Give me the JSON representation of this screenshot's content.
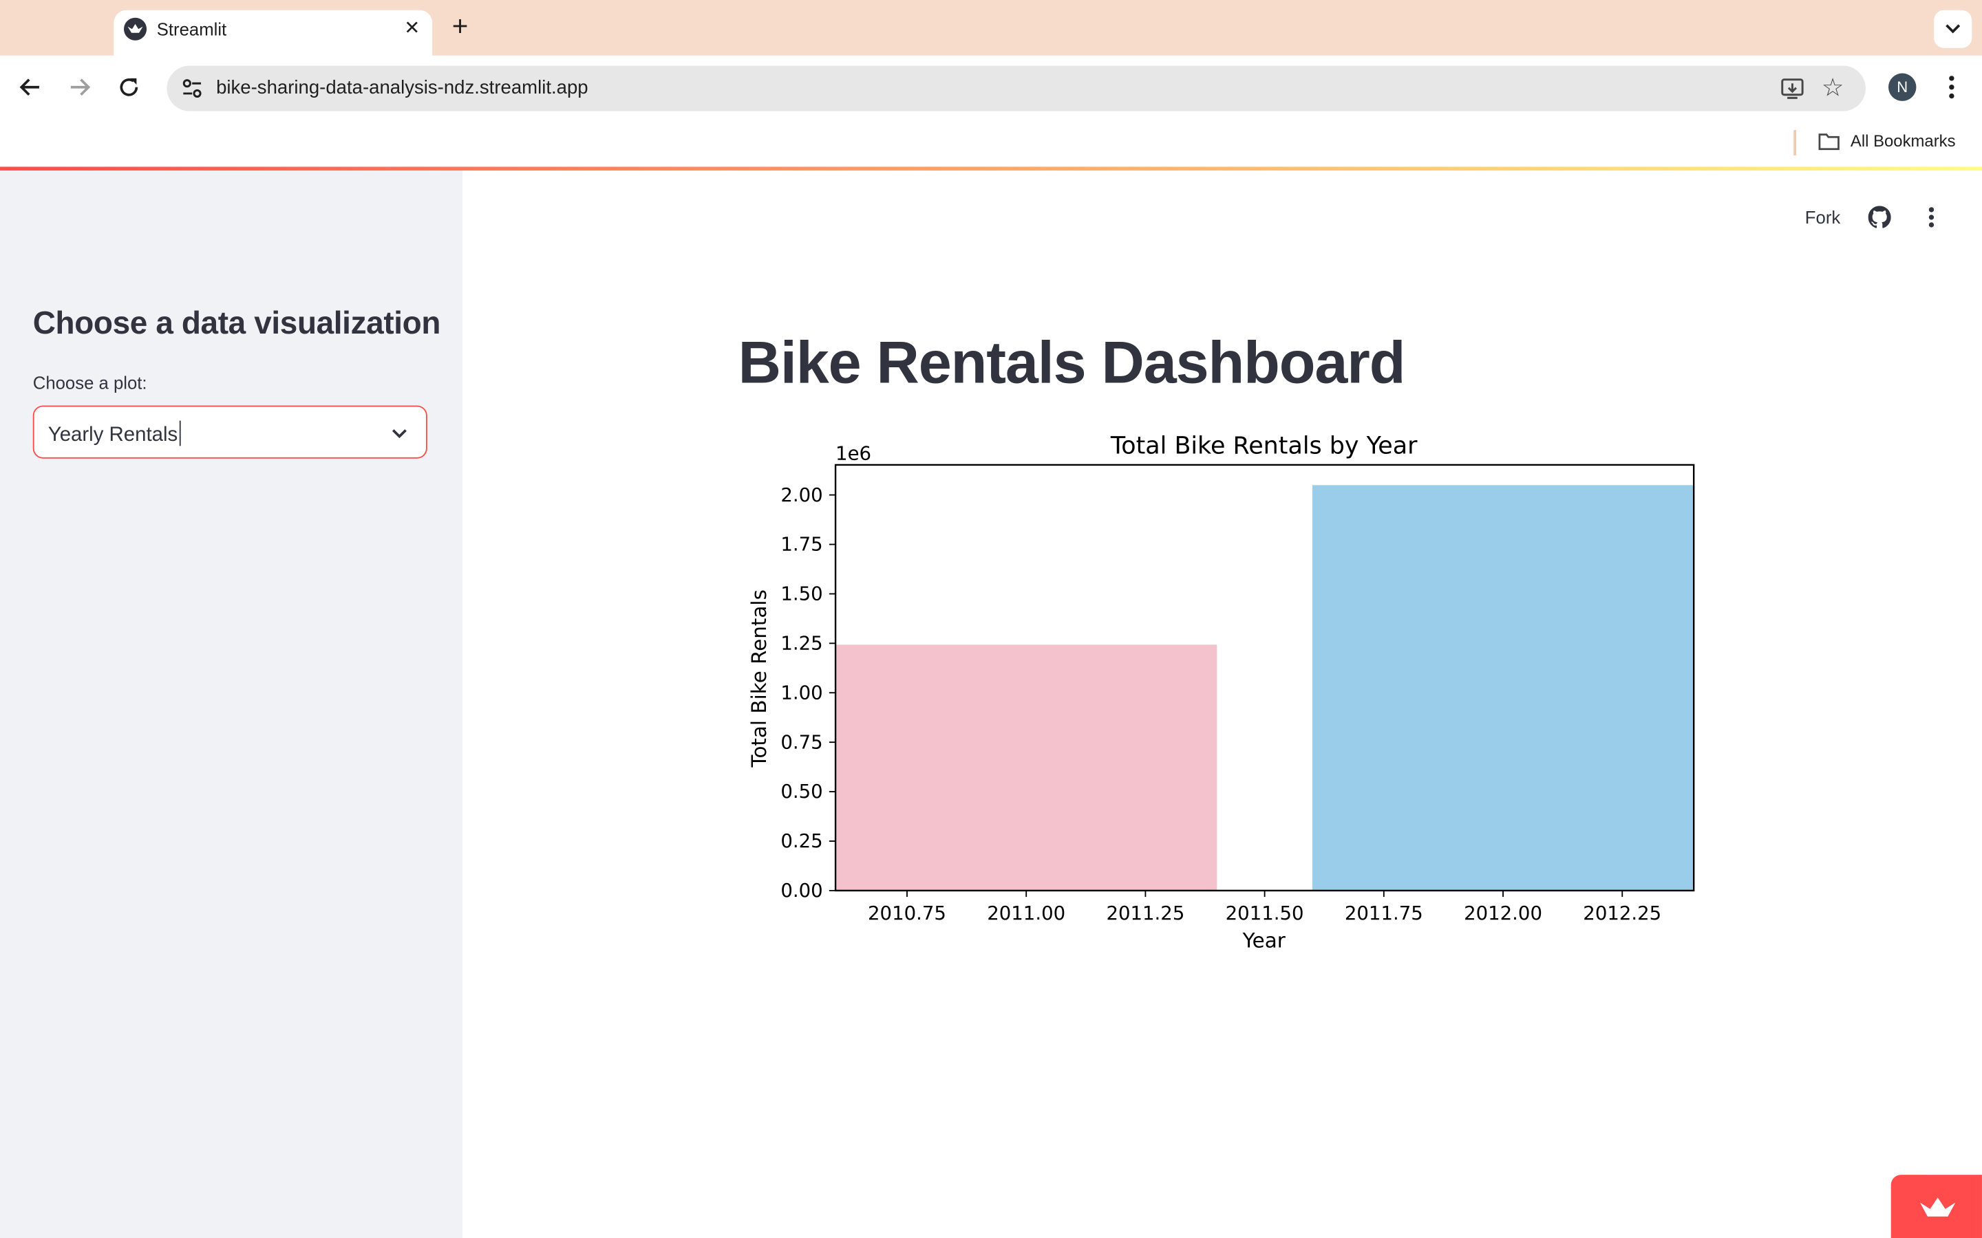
{
  "browser": {
    "tab_title": "Streamlit",
    "url": "bike-sharing-data-analysis-ndz.streamlit.app",
    "bookmarks_label": "All Bookmarks",
    "profile_initial": "N"
  },
  "app": {
    "header": {
      "fork_label": "Fork"
    },
    "sidebar": {
      "title": "Choose a data visualization",
      "select_label": "Choose a plot:",
      "select_value": "Yearly Rentals"
    },
    "main": {
      "title": "Bike Rentals Dashboard"
    }
  },
  "colors": {
    "accent": "#ff4b4b",
    "sidebar_bg": "#f0f2f6",
    "bar_2011": "#f4c2cc",
    "bar_2012": "#99cde9"
  },
  "chart_data": {
    "type": "bar",
    "title": "Total Bike Rentals by Year",
    "xlabel": "Year",
    "ylabel": "Total Bike Rentals",
    "offset_label": "1e6",
    "x": [
      2011,
      2012
    ],
    "values": [
      1243103,
      2049576
    ],
    "colors": [
      "#f4c2cc",
      "#99cde9"
    ],
    "bar_width": 0.8,
    "xlim": [
      2010.6,
      2012.4
    ],
    "ylim": [
      0,
      2152000.0
    ],
    "xticks": [
      "2010.75",
      "2011.00",
      "2011.25",
      "2011.50",
      "2011.75",
      "2012.00",
      "2012.25"
    ],
    "yticks": [
      "0.00",
      "0.25",
      "0.50",
      "0.75",
      "1.00",
      "1.25",
      "1.50",
      "1.75",
      "2.00"
    ],
    "grid": false,
    "legend": "none"
  }
}
